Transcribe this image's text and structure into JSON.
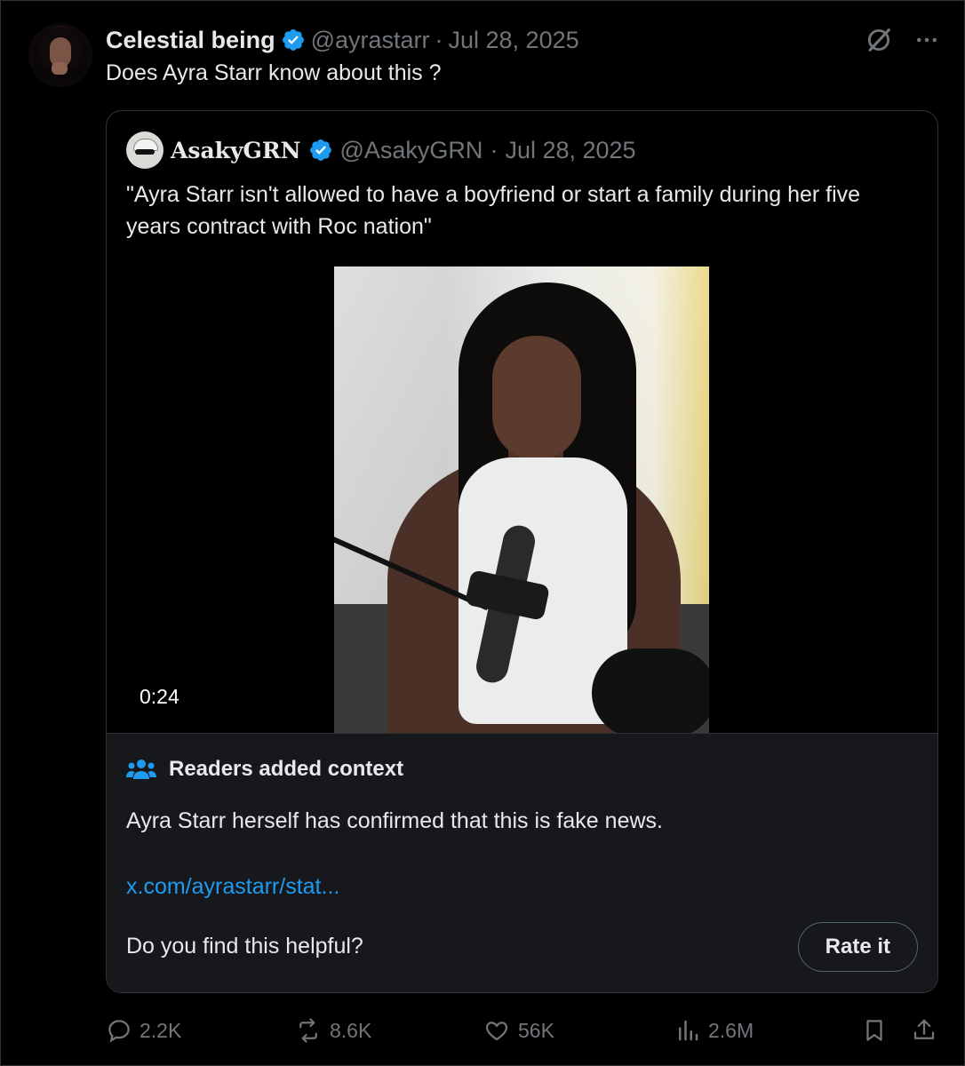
{
  "post": {
    "author_name": "Celestial being",
    "handle": "@ayrastarr",
    "separator": "·",
    "date": "Jul 28, 2025",
    "text": "Does Ayra Starr know about this ?"
  },
  "quoted": {
    "author_name": "AsakyGRN",
    "handle": "@AsakyGRN",
    "separator": "·",
    "date": "Jul 28, 2025",
    "text": "\"Ayra Starr isn't allowed to have a boyfriend or start a family during her five years contract with Roc nation\"",
    "video_time": "0:24"
  },
  "community_note": {
    "title": "Readers added context",
    "body": "Ayra Starr herself has confirmed that this is fake news.",
    "link": "x.com/ayrastarr/stat...",
    "question": "Do you find this helpful?",
    "rate_label": "Rate it"
  },
  "actions": {
    "replies": "2.2K",
    "reposts": "8.6K",
    "likes": "56K",
    "views": "2.6M"
  },
  "colors": {
    "background": "#000000",
    "text": "#e7e9ea",
    "muted": "#71767b",
    "link": "#1d9bf0",
    "verified": "#1d9bf0",
    "note_bg": "#16181c"
  },
  "icons": [
    "grok-icon",
    "more-icon",
    "verified-badge-icon",
    "community-notes-icon",
    "reply-icon",
    "repost-icon",
    "like-icon",
    "views-icon",
    "bookmark-icon",
    "share-icon"
  ]
}
